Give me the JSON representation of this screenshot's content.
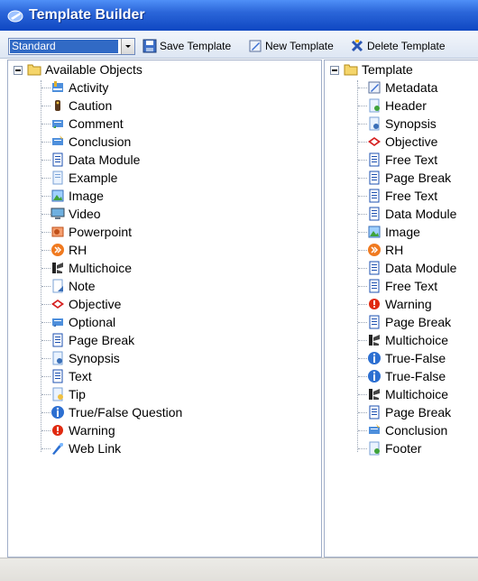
{
  "window": {
    "title": "Template Builder"
  },
  "toolbar": {
    "dropdown_value": "Standard",
    "save_label": "Save Template",
    "new_label": "New Template",
    "delete_label": "Delete Template"
  },
  "left_tree": {
    "root_label": "Available Objects",
    "items": [
      {
        "label": "Activity",
        "icon": "activity-icon"
      },
      {
        "label": "Caution",
        "icon": "caution-icon"
      },
      {
        "label": "Comment",
        "icon": "comment-icon"
      },
      {
        "label": "Conclusion",
        "icon": "conclusion-icon"
      },
      {
        "label": "Data Module",
        "icon": "data-module-icon"
      },
      {
        "label": "Example",
        "icon": "example-icon"
      },
      {
        "label": "Image",
        "icon": "image-icon"
      },
      {
        "label": "Video",
        "icon": "video-icon"
      },
      {
        "label": "Powerpoint",
        "icon": "powerpoint-icon"
      },
      {
        "label": "RH",
        "icon": "rh-icon"
      },
      {
        "label": "Multichoice",
        "icon": "multichoice-icon"
      },
      {
        "label": "Note",
        "icon": "note-icon"
      },
      {
        "label": "Objective",
        "icon": "objective-icon"
      },
      {
        "label": "Optional",
        "icon": "optional-icon"
      },
      {
        "label": "Page Break",
        "icon": "page-break-icon"
      },
      {
        "label": "Synopsis",
        "icon": "synopsis-icon"
      },
      {
        "label": "Text",
        "icon": "text-icon"
      },
      {
        "label": "Tip",
        "icon": "tip-icon"
      },
      {
        "label": "True/False Question",
        "icon": "true-false-icon"
      },
      {
        "label": "Warning",
        "icon": "warning-icon"
      },
      {
        "label": "Web Link",
        "icon": "web-link-icon"
      }
    ]
  },
  "right_tree": {
    "root_label": "Template",
    "items": [
      {
        "label": "Metadata",
        "icon": "metadata-icon"
      },
      {
        "label": "Header",
        "icon": "header-icon"
      },
      {
        "label": "Synopsis",
        "icon": "synopsis-icon"
      },
      {
        "label": "Objective",
        "icon": "objective-icon"
      },
      {
        "label": "Free Text",
        "icon": "text-icon"
      },
      {
        "label": "Page Break",
        "icon": "page-break-icon"
      },
      {
        "label": "Free Text",
        "icon": "text-icon"
      },
      {
        "label": "Data Module",
        "icon": "data-module-icon"
      },
      {
        "label": "Image",
        "icon": "image-icon"
      },
      {
        "label": "RH",
        "icon": "rh-icon"
      },
      {
        "label": "Data Module",
        "icon": "data-module-icon"
      },
      {
        "label": "Free Text",
        "icon": "text-icon"
      },
      {
        "label": "Warning",
        "icon": "warning-icon"
      },
      {
        "label": "Page Break",
        "icon": "page-break-icon"
      },
      {
        "label": "Multichoice",
        "icon": "multichoice-icon"
      },
      {
        "label": "True-False",
        "icon": "true-false-icon"
      },
      {
        "label": "True-False",
        "icon": "true-false-icon"
      },
      {
        "label": "Multichoice",
        "icon": "multichoice-icon"
      },
      {
        "label": "Page Break",
        "icon": "page-break-icon"
      },
      {
        "label": "Conclusion",
        "icon": "conclusion-icon"
      },
      {
        "label": "Footer",
        "icon": "footer-icon"
      }
    ]
  }
}
